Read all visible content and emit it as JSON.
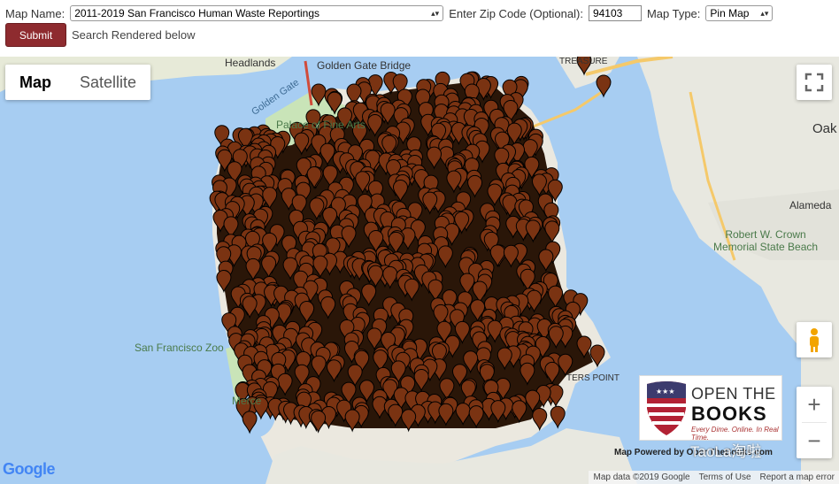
{
  "form": {
    "map_name_label": "Map Name:",
    "map_name_value": "2011-2019 San Francisco Human Waste Reportings",
    "zip_label": "Enter Zip Code (Optional):",
    "zip_value": "94103",
    "map_type_label": "Map Type:",
    "map_type_value": "Pin Map",
    "submit_label": "Submit",
    "rendered_text": "Search Rendered below"
  },
  "map": {
    "type_controls": {
      "map": "Map",
      "satellite": "Satellite"
    },
    "zoom_in": "+",
    "zoom_out": "−",
    "place_labels": {
      "headlands": "Headlands",
      "golden_gate_bridge": "Golden Gate Bridge",
      "golden_gate": "Golden Gate",
      "palace": "Palace of Fine Arts",
      "oakland": "Oak",
      "alameda": "Alameda",
      "crown_beach": "Robert W. Crown\nMemorial State Beach",
      "sf_zoo": "San Francisco Zoo",
      "merced": "Merce",
      "point": "TERS POINT",
      "treasure": "TREASURE"
    },
    "pin_color": "#7a3312",
    "pin_border": "#000000",
    "water_color": "#a7cdf2",
    "land_color": "#e8e8e0"
  },
  "branding": {
    "otb_line1": "OPEN THE",
    "otb_line2": "BOOKS",
    "otb_tag": "Every Dime. Online. In Real Time.",
    "powered_by": "Map Powered by OpenTheBooks.com",
    "watermark": "TaoLa淘啦",
    "google": "Google"
  },
  "attribution": {
    "map_data": "Map data ©2019 Google",
    "terms": "Terms of Use",
    "report": "Report a map error"
  }
}
